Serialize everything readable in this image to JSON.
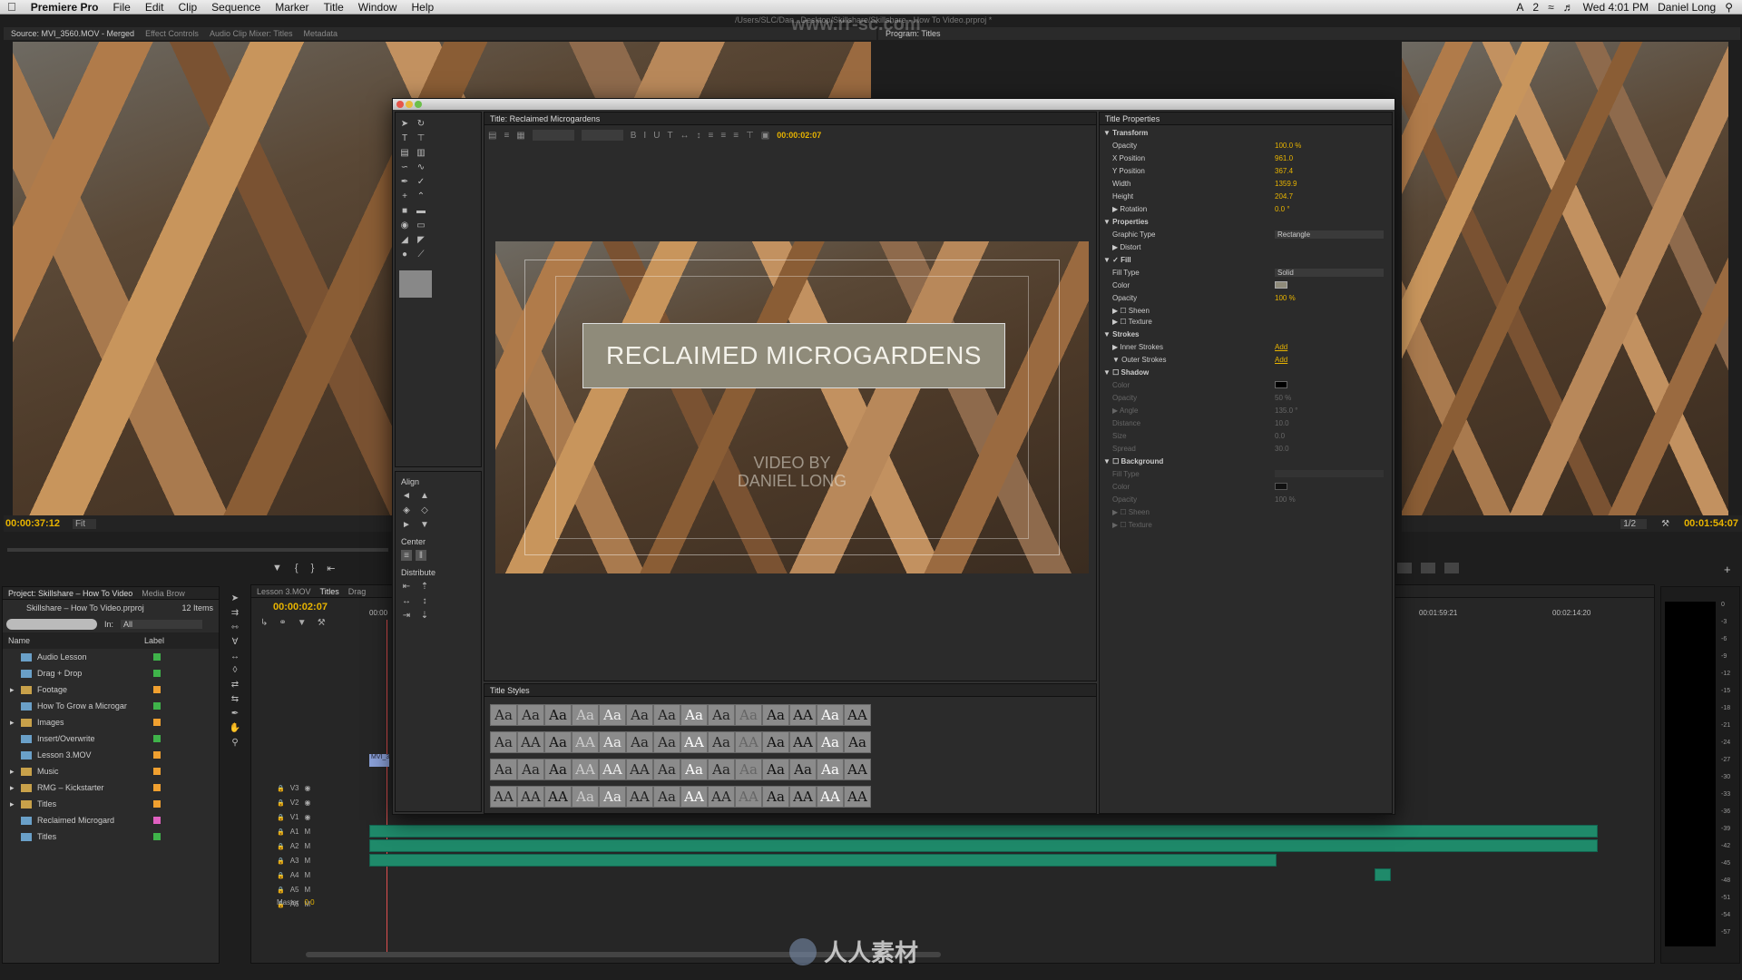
{
  "menubar": {
    "apple": "",
    "app": "Premiere Pro",
    "items": [
      "File",
      "Edit",
      "Clip",
      "Sequence",
      "Marker",
      "Title",
      "Window",
      "Help"
    ],
    "battery": "2",
    "clock": "Wed 4:01 PM",
    "user": "Daniel Long"
  },
  "window_title": "/Users/SLC/Dan...Desktop/Skillshare/Skillshare - How To Video.prproj *",
  "source": {
    "tabs": [
      "Source: MVI_3560.MOV - Merged",
      "Effect Controls",
      "Audio Clip Mixer: Titles",
      "Metadata"
    ],
    "timecode": "00:00:37:12",
    "fit": "Fit"
  },
  "program": {
    "tab": "Program: Titles",
    "timecode": "00:01:54:07",
    "zoom": "1/2"
  },
  "titler": {
    "tab": "Title: Reclaimed Microgardens",
    "timecode": "00:00:02:07",
    "title_text": "RECLAIMED MICROGARDENS",
    "subtitle_line1": "VIDEO BY",
    "subtitle_line2": "DANIEL LONG",
    "align_label": "Align",
    "center_label": "Center",
    "distribute_label": "Distribute",
    "styles_tab": "Title Styles",
    "styles": [
      "Aa",
      "Aa",
      "Aa",
      "Aa",
      "Aa",
      "Aa",
      "Aa",
      "Aa",
      "Aa",
      "Aa",
      "Aa",
      "AA",
      "Aa",
      "AA",
      "Aa",
      "AA",
      "Aa",
      "AA",
      "Aa",
      "Aa",
      "Aa",
      "AA",
      "Aa",
      "AA",
      "Aa",
      "AA",
      "Aa",
      "Aa",
      "Aa",
      "Aa",
      "Aa",
      "AA",
      "AA",
      "AA",
      "Aa",
      "Aa",
      "Aa",
      "Aa",
      "Aa",
      "Aa",
      "Aa",
      "AA",
      "AA",
      "AA",
      "AA",
      "Aa",
      "Aa",
      "AA",
      "Aa",
      "AA",
      "AA",
      "AA",
      "Aa",
      "AA",
      "AA",
      "AA"
    ]
  },
  "title_properties": {
    "tab": "Title Properties",
    "transform": "Transform",
    "opacity_label": "Opacity",
    "opacity": "100.0 %",
    "xpos_label": "X Position",
    "xpos": "961.0",
    "ypos_label": "Y Position",
    "ypos": "367.4",
    "width_label": "Width",
    "width": "1359.9",
    "height_label": "Height",
    "height": "204.7",
    "rotation_label": "Rotation",
    "rotation": "0.0 °",
    "properties": "Properties",
    "graphic_type_label": "Graphic Type",
    "graphic_type": "Rectangle",
    "distort": "Distort",
    "fill": "Fill",
    "fill_type_label": "Fill Type",
    "fill_type": "Solid",
    "color_label": "Color",
    "fill_opacity_label": "Opacity",
    "fill_opacity": "100 %",
    "sheen": "Sheen",
    "texture": "Texture",
    "strokes": "Strokes",
    "inner_strokes": "Inner Strokes",
    "outer_strokes": "Outer Strokes",
    "add": "Add",
    "shadow": "Shadow",
    "sh_color": "Color",
    "sh_opacity_label": "Opacity",
    "sh_opacity": "50 %",
    "sh_angle_label": "Angle",
    "sh_angle": "135.0 °",
    "sh_distance_label": "Distance",
    "sh_distance": "10.0",
    "sh_size_label": "Size",
    "sh_size": "0.0",
    "sh_spread_label": "Spread",
    "sh_spread": "30.0",
    "background": "Background",
    "bg_fill_type": "Fill Type",
    "bg_color": "Color",
    "bg_opacity_label": "Opacity",
    "bg_opacity": "100 %",
    "bg_sheen": "Sheen",
    "bg_texture": "Texture"
  },
  "project": {
    "tabs": [
      "Project: Skillshare – How To Video",
      "Media Brow"
    ],
    "file": "Skillshare – How To Video.prproj",
    "count": "12 Items",
    "in_label": "In:",
    "in_value": "All",
    "col_name": "Name",
    "col_label": "Label",
    "items": [
      {
        "name": "Audio Lesson",
        "color": "#3fb34a",
        "folder": false
      },
      {
        "name": "Drag + Drop",
        "color": "#3fb34a",
        "folder": false
      },
      {
        "name": "Footage",
        "color": "#f0a030",
        "folder": true
      },
      {
        "name": "How To Grow a Microgar",
        "color": "#3fb34a",
        "folder": false
      },
      {
        "name": "Images",
        "color": "#f0a030",
        "folder": true
      },
      {
        "name": "Insert/Overwrite",
        "color": "#3fb34a",
        "folder": false
      },
      {
        "name": "Lesson 3.MOV",
        "color": "#f0a030",
        "folder": false
      },
      {
        "name": "Music",
        "color": "#f0a030",
        "folder": true
      },
      {
        "name": "RMG – Kickstarter",
        "color": "#f0a030",
        "folder": true
      },
      {
        "name": "Titles",
        "color": "#f0a030",
        "folder": true
      },
      {
        "name": "Reclaimed Microgard",
        "color": "#e060c0",
        "folder": false
      },
      {
        "name": "Titles",
        "color": "#3fb34a",
        "folder": false
      }
    ]
  },
  "timeline": {
    "tabs": [
      "Lesson 3.MOV",
      "Titles",
      "Drag"
    ],
    "timecode": "00:00:02:07",
    "ruler_start": "00:00",
    "ruler_a": "00:01:59:21",
    "ruler_b": "00:02:14:20",
    "tracks": [
      "V3",
      "V2",
      "V1",
      "A1",
      "A2",
      "A3",
      "A4",
      "A5",
      "A6"
    ],
    "master_label": "Master",
    "master_value": "0.0",
    "clip_label": "MVI_3"
  },
  "meter_labels": [
    "0",
    "-3",
    "-6",
    "-9",
    "-12",
    "-15",
    "-18",
    "-21",
    "-24",
    "-27",
    "-30",
    "-33",
    "-36",
    "-39",
    "-42",
    "-45",
    "-48",
    "-51",
    "-54",
    "-57"
  ],
  "watermark": {
    "url": "www.rr-sc.com",
    "brand": "人人素材"
  },
  "colors": {
    "accent": "#e8b400",
    "clip": "#1f8a6a",
    "title_box": "#8f8b7a"
  }
}
